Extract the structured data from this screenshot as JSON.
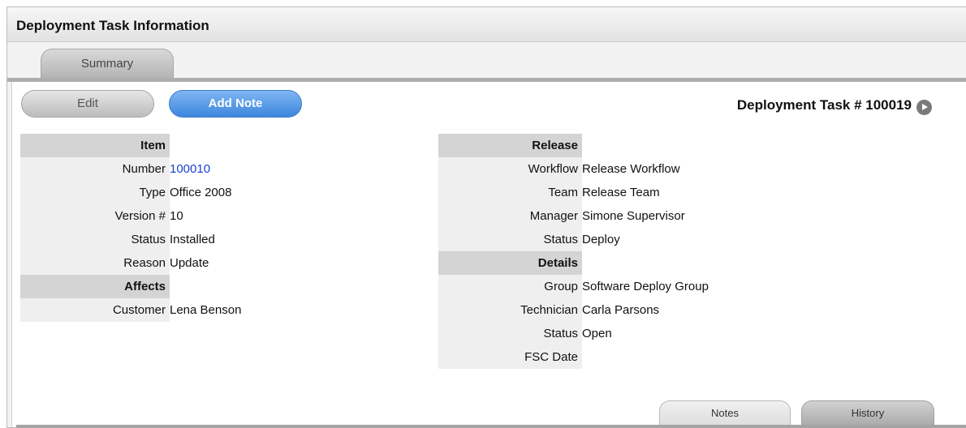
{
  "panel": {
    "title": "Deployment Task Information"
  },
  "tabs": {
    "summary": "Summary"
  },
  "toolbar": {
    "edit_label": "Edit",
    "add_note_label": "Add Note"
  },
  "task": {
    "heading": "Deployment Task # 100019"
  },
  "item": {
    "section": "Item",
    "number_label": "Number",
    "number": "100010",
    "type_label": "Type",
    "type": "Office 2008",
    "version_label": "Version #",
    "version": "10",
    "status_label": "Status",
    "status": "Installed",
    "reason_label": "Reason",
    "reason": "Update"
  },
  "affects": {
    "section": "Affects",
    "customer_label": "Customer",
    "customer": "Lena Benson"
  },
  "release": {
    "section": "Release",
    "workflow_label": "Workflow",
    "workflow": "Release Workflow",
    "team_label": "Team",
    "team": "Release Team",
    "manager_label": "Manager",
    "manager": "Simone Supervisor",
    "status_label": "Status",
    "status": "Deploy"
  },
  "details": {
    "section": "Details",
    "group_label": "Group",
    "group": "Software Deploy Group",
    "technician_label": "Technician",
    "technician": "Carla Parsons",
    "status_label": "Status",
    "status": "Open",
    "fsc_label": "FSC Date",
    "fsc": ""
  },
  "bottom_tabs": {
    "notes": "Notes",
    "history": "History"
  },
  "colors": {
    "accent_button": "#4a90e2",
    "link": "#1a3fd4",
    "section_bg": "#d4d4d4"
  },
  "icons": {
    "next": "play-circle-icon"
  }
}
